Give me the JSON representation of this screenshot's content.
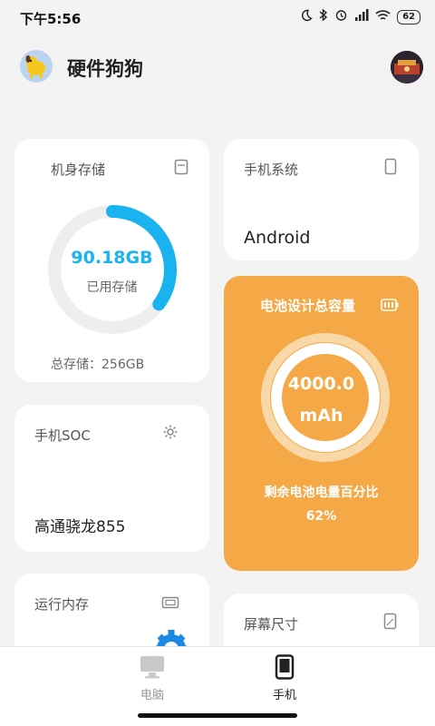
{
  "status_bar": {
    "time": "下午5:56",
    "battery": "62"
  },
  "header": {
    "title": "硬件狗狗"
  },
  "storage": {
    "title": "机身存储",
    "used_value": "90.18GB",
    "used_label": "已用存储",
    "total_label": "总存储：256GB",
    "used_fraction": 0.352
  },
  "system": {
    "title": "手机系统",
    "value": "Android"
  },
  "battery": {
    "title": "电池设计总容量",
    "capacity_value": "4000.0",
    "capacity_unit": "mAh",
    "remaining_label": "剩余电池电量百分比",
    "remaining_percent": "62%",
    "remaining_fraction": 0.62
  },
  "soc": {
    "title": "手机SOC",
    "value": "高通骁龙855"
  },
  "ram": {
    "title": "运行内存"
  },
  "screen": {
    "title": "屏幕尺寸"
  },
  "bottom_nav": {
    "items": [
      {
        "label": "电脑",
        "icon": "monitor-icon",
        "active": false
      },
      {
        "label": "手机",
        "icon": "phone-icon",
        "active": true
      }
    ]
  },
  "colors": {
    "accent_blue": "#19b3f0",
    "ring_gray": "#eeeeee",
    "battery_orange": "#f5a846",
    "battery_ring_light": "#f9d8a8",
    "gear_blue": "#1e88e5"
  }
}
